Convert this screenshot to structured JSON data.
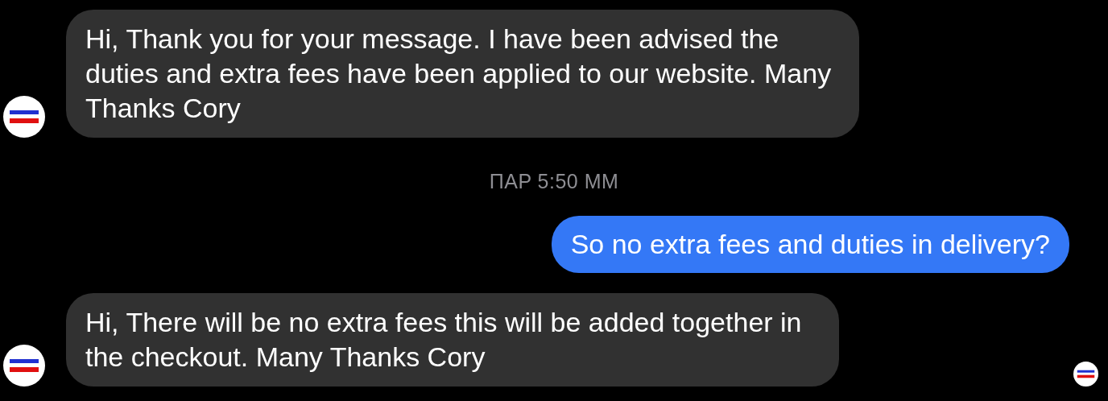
{
  "messages": [
    {
      "kind": "incoming",
      "text": "Hi, Thank you for your message. I have been advised the duties and extra fees have been applied to our website. Many Thanks Cory",
      "seen": false
    },
    {
      "kind": "timestamp",
      "text": "ΠΑΡ 5:50 ΜΜ",
      "seen": false
    },
    {
      "kind": "outgoing",
      "text": "So no extra fees and duties in delivery?",
      "seen": false
    },
    {
      "kind": "incoming",
      "text": "Hi, There will be no extra fees this will be added together in the checkout. Many Thanks Cory",
      "seen": true
    }
  ]
}
